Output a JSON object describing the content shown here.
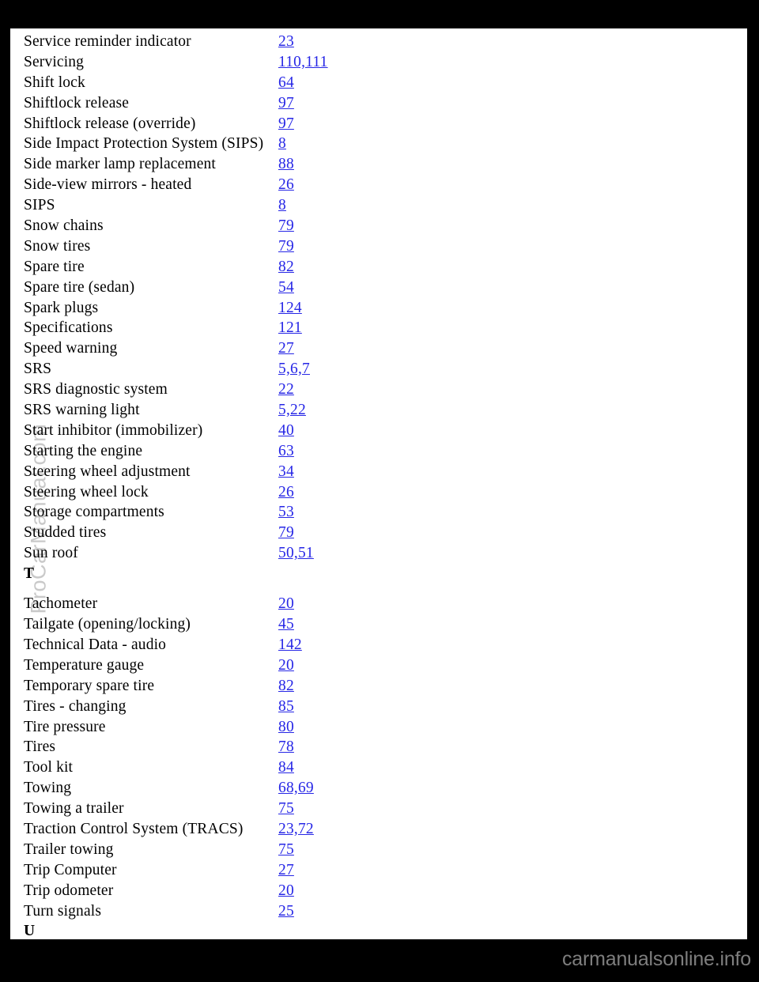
{
  "document": {
    "type": "manual-index-page",
    "watermark": "ProCarManual.com",
    "footer_brand": "carmanualsonline.info",
    "link_color": "#2626e6",
    "text_color": "#000000",
    "page_background": "#ffffff",
    "canvas_background": "#000000",
    "watermark_color": "#c9c9c9",
    "footer_color": "#7e7e7e"
  },
  "index": {
    "rows": [
      {
        "kind": "entry",
        "label": "Service reminder indicator",
        "pages": "23"
      },
      {
        "kind": "entry",
        "label": "Servicing",
        "pages": "110,111"
      },
      {
        "kind": "entry",
        "label": "Shift lock",
        "pages": "64"
      },
      {
        "kind": "entry",
        "label": "Shiftlock release",
        "pages": "97"
      },
      {
        "kind": "entry",
        "label": "Shiftlock release (override)",
        "pages": "97"
      },
      {
        "kind": "entry",
        "label": "Side Impact Protection System (SIPS)",
        "pages": "8"
      },
      {
        "kind": "entry",
        "label": "Side marker lamp replacement",
        "pages": "88"
      },
      {
        "kind": "entry",
        "label": "Side-view mirrors - heated",
        "pages": "26"
      },
      {
        "kind": "entry",
        "label": "SIPS",
        "pages": "8"
      },
      {
        "kind": "entry",
        "label": "Snow chains",
        "pages": "79"
      },
      {
        "kind": "entry",
        "label": "Snow tires",
        "pages": "79"
      },
      {
        "kind": "entry",
        "label": "Spare tire",
        "pages": "82"
      },
      {
        "kind": "entry",
        "label": "Spare tire (sedan)",
        "pages": "54"
      },
      {
        "kind": "entry",
        "label": "Spark plugs",
        "pages": "124"
      },
      {
        "kind": "entry",
        "label": "Specifications",
        "pages": "121"
      },
      {
        "kind": "entry",
        "label": "Speed warning",
        "pages": "27"
      },
      {
        "kind": "entry",
        "label": "SRS",
        "pages": "5,6,7"
      },
      {
        "kind": "entry",
        "label": "SRS diagnostic system",
        "pages": "22"
      },
      {
        "kind": "entry",
        "label": "SRS warning light",
        "pages": "5,22"
      },
      {
        "kind": "entry",
        "label": "Start inhibitor (immobilizer)",
        "pages": "40"
      },
      {
        "kind": "entry",
        "label": "Starting the engine",
        "pages": "63"
      },
      {
        "kind": "entry",
        "label": "Steering wheel adjustment",
        "pages": "34"
      },
      {
        "kind": "entry",
        "label": "Steering wheel lock",
        "pages": "26"
      },
      {
        "kind": "entry",
        "label": "Storage compartments",
        "pages": "53"
      },
      {
        "kind": "entry",
        "label": "Studded tires",
        "pages": "79"
      },
      {
        "kind": "entry",
        "label": "Sun roof",
        "pages": "50,51"
      },
      {
        "kind": "section",
        "label": "T"
      },
      {
        "kind": "entry",
        "label": "Tachometer",
        "pages": "20"
      },
      {
        "kind": "entry",
        "label": "Tailgate (opening/locking)",
        "pages": "45"
      },
      {
        "kind": "entry",
        "label": "Technical Data - audio",
        "pages": "142"
      },
      {
        "kind": "entry",
        "label": "Temperature gauge",
        "pages": "20"
      },
      {
        "kind": "entry",
        "label": "Temporary spare tire",
        "pages": "82"
      },
      {
        "kind": "entry",
        "label": "Tires - changing",
        "pages": "85"
      },
      {
        "kind": "entry",
        "label": "Tire pressure",
        "pages": "80"
      },
      {
        "kind": "entry",
        "label": "Tires",
        "pages": "78"
      },
      {
        "kind": "entry",
        "label": "Tool kit",
        "pages": "84"
      },
      {
        "kind": "entry",
        "label": "Towing",
        "pages": "68,69"
      },
      {
        "kind": "entry",
        "label": "Towing a trailer",
        "pages": "75"
      },
      {
        "kind": "entry",
        "label": "Traction Control System (TRACS)",
        "pages": "23,72"
      },
      {
        "kind": "entry",
        "label": "Trailer towing",
        "pages": "75"
      },
      {
        "kind": "entry",
        "label": "Trip Computer",
        "pages": "27"
      },
      {
        "kind": "entry",
        "label": "Trip odometer",
        "pages": "20"
      },
      {
        "kind": "entry",
        "label": "Turn signals",
        "pages": "25"
      },
      {
        "kind": "section",
        "label": "U"
      }
    ]
  }
}
